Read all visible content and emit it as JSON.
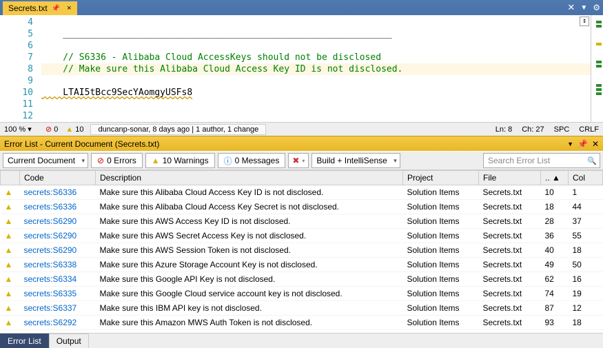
{
  "tab": {
    "title": "Secrets.txt",
    "pinned": true
  },
  "editor": {
    "lines": [
      {
        "n": 4,
        "text": ""
      },
      {
        "n": 5,
        "text": "    _____________________________________________________________"
      },
      {
        "n": 6,
        "text": ""
      },
      {
        "n": 7,
        "text": "    // S6336 - Alibaba Cloud AccessKeys should not be disclosed",
        "comment": true
      },
      {
        "n": 8,
        "text": "    // Make sure this Alibaba Cloud Access Key ID is not disclosed.",
        "comment": true,
        "hl": true
      },
      {
        "n": 9,
        "text": ""
      },
      {
        "n": 10,
        "text": "    LTAI5tBcc9SecYAomgyUSFs8",
        "wavy": true
      },
      {
        "n": 11,
        "text": ""
      },
      {
        "n": 12,
        "text": ""
      }
    ]
  },
  "status": {
    "zoom": "100 %",
    "errors": "0",
    "warnings": "10",
    "blame": "duncanp-sonar, 8 days ago | 1 author, 1 change",
    "ln_label": "Ln:",
    "ln": "8",
    "ch_label": "Ch:",
    "ch": "27",
    "spc": "SPC",
    "crlf": "CRLF"
  },
  "panel": {
    "title": "Error List - Current Document (Secrets.txt)",
    "scope": "Current Document",
    "errors_btn": "0 Errors",
    "warnings_btn": "10 Warnings",
    "messages_btn": "0 Messages",
    "filter_select": "Build + IntelliSense",
    "search_placeholder": "Search Error List"
  },
  "columns": {
    "code": "Code",
    "description": "Description",
    "project": "Project",
    "file": "File",
    "line": "..",
    "col": "Col"
  },
  "rows": [
    {
      "code": "secrets:S6336",
      "desc": "Make sure this Alibaba Cloud Access Key ID is not disclosed.",
      "proj": "Solution Items",
      "file": "Secrets.txt",
      "line": "10",
      "col": "1"
    },
    {
      "code": "secrets:S6336",
      "desc": "Make sure this Alibaba Cloud Access Key Secret is not disclosed.",
      "proj": "Solution Items",
      "file": "Secrets.txt",
      "line": "18",
      "col": "44"
    },
    {
      "code": "secrets:S6290",
      "desc": "Make sure this AWS Access Key ID is not disclosed.",
      "proj": "Solution Items",
      "file": "Secrets.txt",
      "line": "28",
      "col": "37"
    },
    {
      "code": "secrets:S6290",
      "desc": "Make sure this AWS Secret Access Key is not disclosed.",
      "proj": "Solution Items",
      "file": "Secrets.txt",
      "line": "36",
      "col": "55"
    },
    {
      "code": "secrets:S6290",
      "desc": "Make sure this AWS Session Token is not disclosed.",
      "proj": "Solution Items",
      "file": "Secrets.txt",
      "line": "40",
      "col": "18"
    },
    {
      "code": "secrets:S6338",
      "desc": "Make sure this Azure Storage Account Key is not disclosed.",
      "proj": "Solution Items",
      "file": "Secrets.txt",
      "line": "49",
      "col": "50"
    },
    {
      "code": "secrets:S6334",
      "desc": "Make sure this Google API Key is not disclosed.",
      "proj": "Solution Items",
      "file": "Secrets.txt",
      "line": "62",
      "col": "16"
    },
    {
      "code": "secrets:S6335",
      "desc": "Make sure this Google Cloud service account key is not disclosed.",
      "proj": "Solution Items",
      "file": "Secrets.txt",
      "line": "74",
      "col": "19"
    },
    {
      "code": "secrets:S6337",
      "desc": "Make sure this IBM API key is not disclosed.",
      "proj": "Solution Items",
      "file": "Secrets.txt",
      "line": "87",
      "col": "12"
    },
    {
      "code": "secrets:S6292",
      "desc": "Make sure this Amazon MWS Auth Token is not disclosed.",
      "proj": "Solution Items",
      "file": "Secrets.txt",
      "line": "93",
      "col": "18"
    }
  ],
  "bottom_tabs": {
    "error_list": "Error List",
    "output": "Output"
  }
}
